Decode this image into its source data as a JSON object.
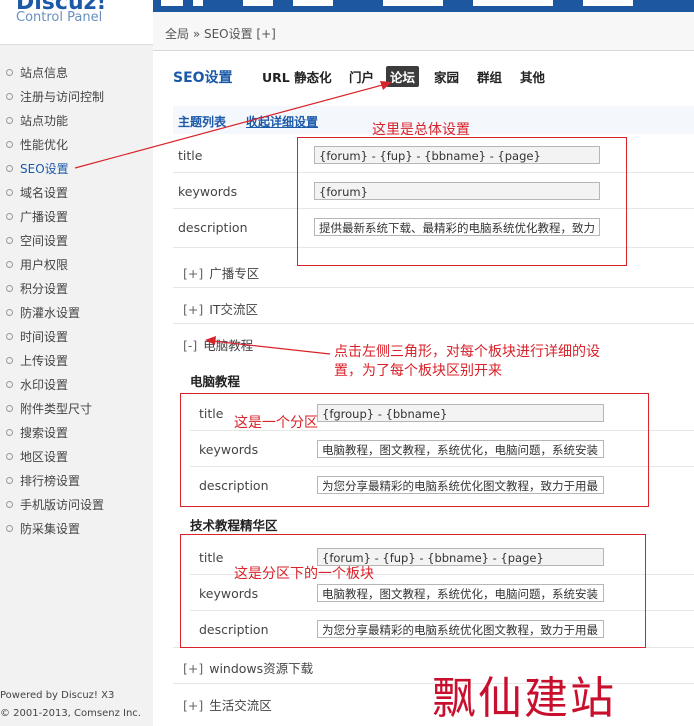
{
  "logo": {
    "title": "Discuz!",
    "subtitle": "Control Panel"
  },
  "breadcrumb": {
    "text": "全局 » SEO设置 [+]"
  },
  "sidebar": {
    "items": [
      {
        "label": "站点信息"
      },
      {
        "label": "注册与访问控制"
      },
      {
        "label": "站点功能"
      },
      {
        "label": "性能优化"
      },
      {
        "label": "SEO设置"
      },
      {
        "label": "域名设置"
      },
      {
        "label": "广播设置"
      },
      {
        "label": "空间设置"
      },
      {
        "label": "用户权限"
      },
      {
        "label": "积分设置"
      },
      {
        "label": "防灌水设置"
      },
      {
        "label": "时间设置"
      },
      {
        "label": "上传设置"
      },
      {
        "label": "水印设置"
      },
      {
        "label": "附件类型尺寸"
      },
      {
        "label": "搜索设置"
      },
      {
        "label": "地区设置"
      },
      {
        "label": "排行榜设置"
      },
      {
        "label": "手机版访问设置"
      },
      {
        "label": "防采集设置"
      }
    ],
    "active_index": 4,
    "footer_powered": "Powered by Discuz! X3",
    "footer_copyright": "© 2001-2013, Comsenz Inc."
  },
  "header": {
    "title": "SEO设置",
    "tabs": [
      {
        "label": "URL 静态化"
      },
      {
        "label": "门户"
      },
      {
        "label": "论坛"
      },
      {
        "label": "家园"
      },
      {
        "label": "群组"
      },
      {
        "label": "其他"
      }
    ],
    "active_tab": "论坛"
  },
  "subnav": {
    "list": "主题列表",
    "collapse": "收起详细设置"
  },
  "global": {
    "labels": {
      "title": "title",
      "keywords": "keywords",
      "description": "description"
    },
    "title": "{forum} - {fup} - {bbname} - {page}",
    "keywords": "{forum}",
    "description": "提供最新系统下载、最精彩的电脑系统优化教程，致力"
  },
  "sections": {
    "s1": {
      "toggle": "[+]",
      "label": "广播专区"
    },
    "s2": {
      "toggle": "[+]",
      "label": "IT交流区"
    },
    "s3": {
      "toggle": "[-]",
      "label": "电脑教程"
    },
    "s4": {
      "toggle": "[+]",
      "label": "windows资源下载"
    },
    "s5": {
      "toggle": "[+]",
      "label": "生活交流区"
    }
  },
  "group": {
    "name": "电脑教程",
    "title": "{fgroup} - {bbname}",
    "keywords": "电脑教程，图文教程，系统优化，电脑问题，系统安装",
    "description": "为您分享最精彩的电脑系统优化图文教程，致力于用最"
  },
  "forum": {
    "name": "技术教程精华区",
    "title": "{forum} - {fup} - {bbname} - {page}",
    "keywords": "电脑教程，图文教程，系统优化，电脑问题，系统安装",
    "description": "为您分享最精彩的电脑系统优化图文教程，致力于用最"
  },
  "annotations": {
    "global_note": "这里是总体设置",
    "toggle_note_1": "点击左侧三角形，对每个板块进行详细的设",
    "toggle_note_2": "置，为了每个板块区别开来",
    "group_note": "这是一个分区",
    "forum_note": "这是分区下的一个板块",
    "color": "#d9222a"
  },
  "watermark": "飘仙建站"
}
